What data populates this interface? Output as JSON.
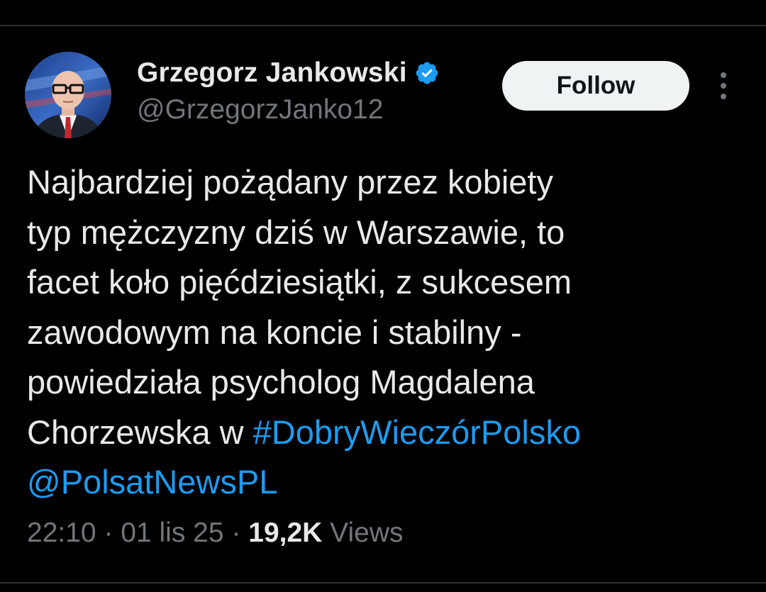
{
  "author": {
    "display_name": "Grzegorz Jankowski",
    "handle": "@GrzegorzJanko12",
    "verified_icon": "verified-badge-icon",
    "avatar": "profile-photo"
  },
  "follow_button": {
    "label": "Follow"
  },
  "more_menu": {
    "icon": "more-vertical-icon"
  },
  "tweet": {
    "lines": [
      "Najbardziej pożądany przez kobiety",
      "typ mężczyzny dziś w Warszawie, to",
      "facet koło pięćdziesiątki, z sukcesem",
      "zawodowym na koncie i stabilny -",
      "powiedziała psycholog Magdalena",
      "Chorzewska w "
    ],
    "hashtag": "#DobryWieczórPolsko",
    "mention": "@PolsatNewsPL"
  },
  "meta": {
    "time": "22:10",
    "separator": "·",
    "date": "01 lis 25",
    "views_count": "19,2K",
    "views_label": "Views"
  },
  "colors": {
    "background": "#000000",
    "text": "#e7e9ea",
    "secondary_text": "#71767b",
    "link": "#1d9bf0",
    "follow_button_bg": "#eff3f4",
    "verified": "#1d9bf0",
    "divider": "#2f3336"
  }
}
